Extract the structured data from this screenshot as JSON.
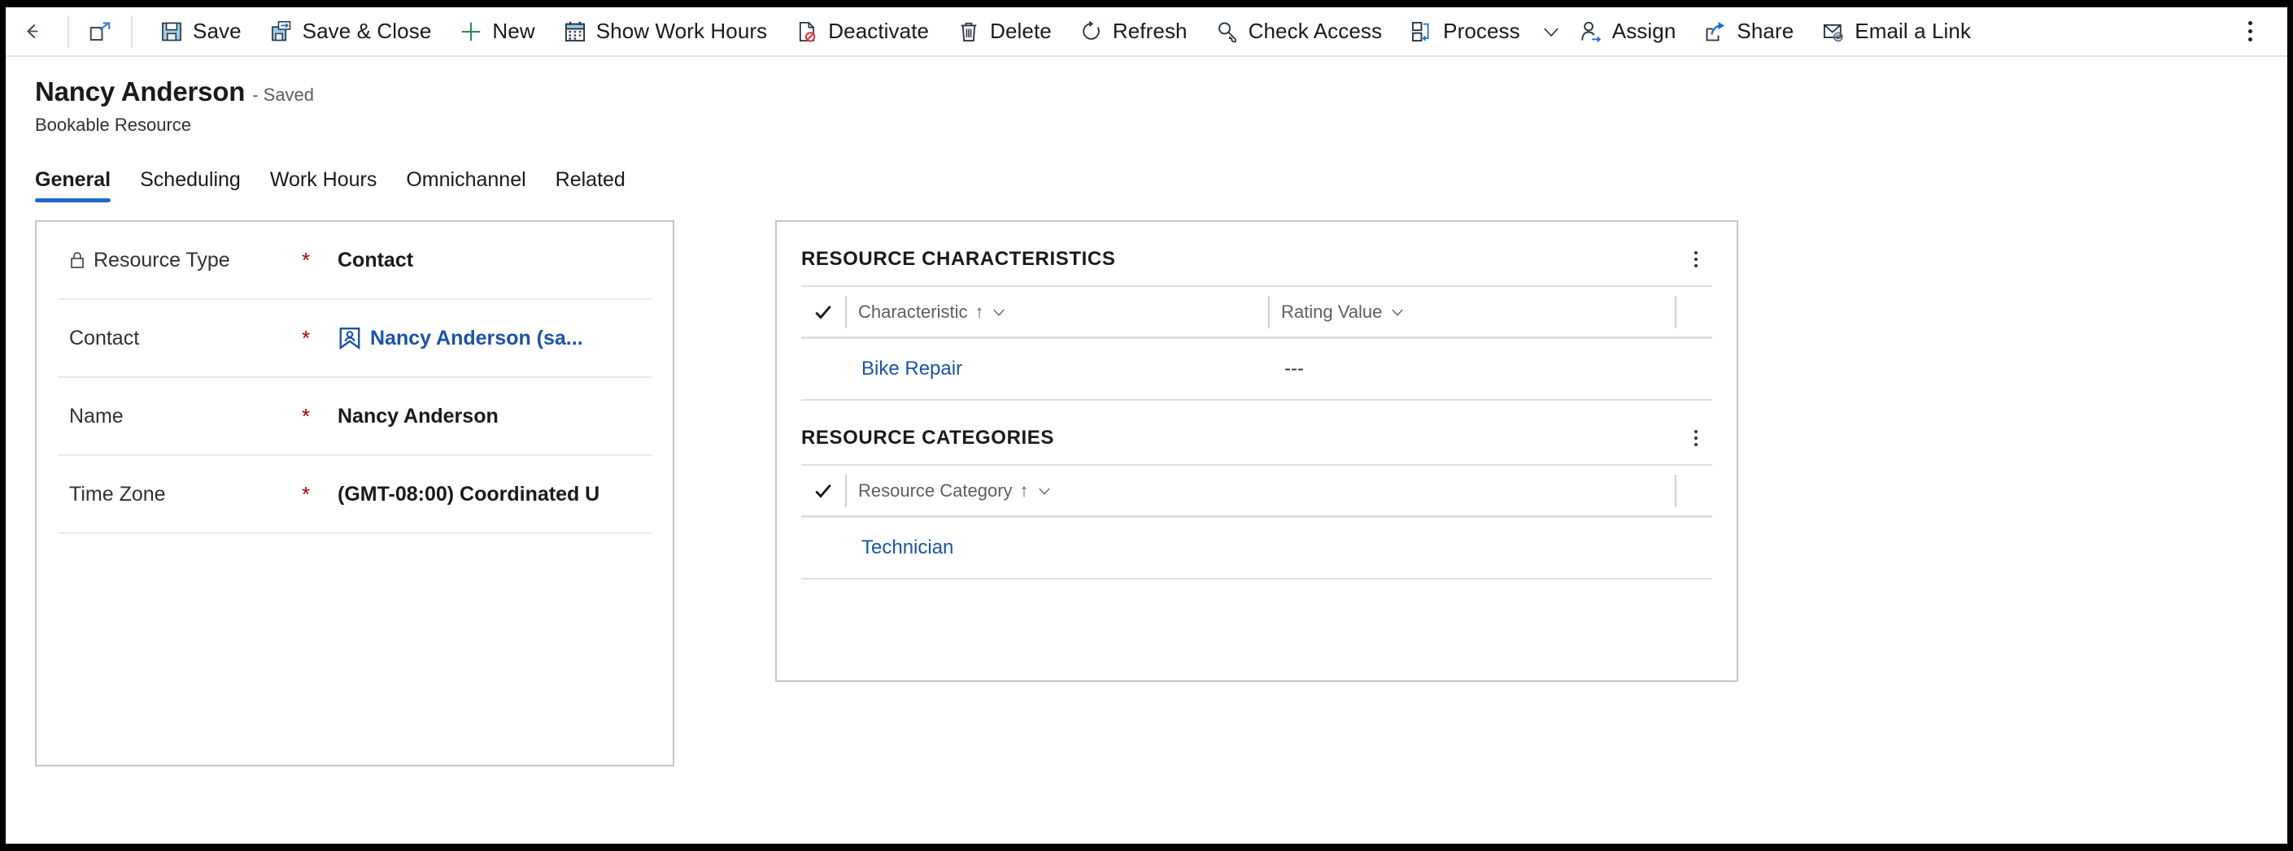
{
  "commandbar": {
    "back": {
      "icon": "back-arrow-icon",
      "label": "Back"
    },
    "popout": {
      "icon": "open-in-new-window-icon",
      "label": "Open in new window"
    },
    "items": [
      {
        "id": "save",
        "label": "Save",
        "icon": "save-icon"
      },
      {
        "id": "save-close",
        "label": "Save & Close",
        "icon": "save-and-close-icon"
      },
      {
        "id": "new",
        "label": "New",
        "icon": "plus-icon"
      },
      {
        "id": "show-work-hours",
        "label": "Show Work Hours",
        "icon": "calendar-icon"
      },
      {
        "id": "deactivate",
        "label": "Deactivate",
        "icon": "deactivate-icon"
      },
      {
        "id": "delete",
        "label": "Delete",
        "icon": "trash-icon"
      },
      {
        "id": "refresh",
        "label": "Refresh",
        "icon": "refresh-icon"
      },
      {
        "id": "check-access",
        "label": "Check Access",
        "icon": "key-icon"
      },
      {
        "id": "process",
        "label": "Process",
        "icon": "process-icon",
        "has_chevron": true
      },
      {
        "id": "assign",
        "label": "Assign",
        "icon": "assign-user-icon"
      },
      {
        "id": "share",
        "label": "Share",
        "icon": "share-icon"
      },
      {
        "id": "email-link",
        "label": "Email a Link",
        "icon": "email-link-icon"
      }
    ],
    "overflow": {
      "icon": "more-commands-icon",
      "label": "More commands"
    }
  },
  "header": {
    "record_title": "Nancy Anderson",
    "record_state": "- Saved",
    "entity_name": "Bookable Resource"
  },
  "tabs": [
    {
      "label": "General",
      "active": true
    },
    {
      "label": "Scheduling",
      "active": false
    },
    {
      "label": "Work Hours",
      "active": false
    },
    {
      "label": "Omnichannel",
      "active": false
    },
    {
      "label": "Related",
      "active": false
    }
  ],
  "form": {
    "fields": [
      {
        "label": "Resource Type",
        "required": "*",
        "value": "Contact",
        "locked": true,
        "is_link": false,
        "has_entity_icon": false
      },
      {
        "label": "Contact",
        "required": "*",
        "value": "Nancy Anderson (sa...",
        "locked": false,
        "is_link": true,
        "has_entity_icon": true
      },
      {
        "label": "Name",
        "required": "*",
        "value": "Nancy Anderson",
        "locked": false,
        "is_link": false,
        "has_entity_icon": false
      },
      {
        "label": "Time Zone",
        "required": "*",
        "value": "(GMT-08:00) Coordinated U",
        "locked": false,
        "is_link": false,
        "has_entity_icon": false
      }
    ]
  },
  "sub_grids": {
    "characteristics": {
      "title": "RESOURCE CHARACTERISTICS",
      "columns": [
        {
          "label": "Characteristic",
          "sorted": true,
          "sort_arrow": "↑"
        },
        {
          "label": "Rating Value",
          "sorted": false,
          "sort_arrow": ""
        }
      ],
      "rows": [
        {
          "characteristic": "Bike Repair",
          "rating_value": "---"
        }
      ]
    },
    "categories": {
      "title": "RESOURCE CATEGORIES",
      "columns": [
        {
          "label": "Resource Category",
          "sorted": true,
          "sort_arrow": "↑"
        }
      ],
      "rows": [
        {
          "resource_category": "Technician"
        }
      ]
    }
  },
  "colors": {
    "accent": "#2266cc",
    "link": "#1a54a6",
    "required": "#a80000",
    "border": "#c8c6c4",
    "text": "#1b1a19"
  }
}
